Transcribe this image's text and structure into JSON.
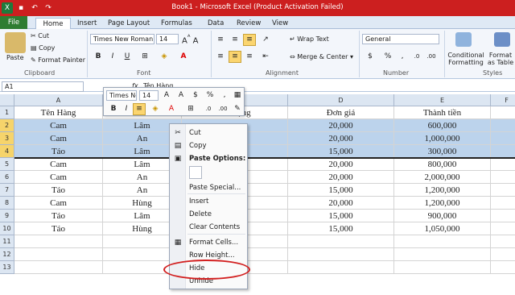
{
  "window": {
    "title": "Book1 -  Microsoft Excel (Product Activation Failed)"
  },
  "tabs": [
    "File",
    "Home",
    "Insert",
    "Page Layout",
    "Formulas",
    "Data",
    "Review",
    "View"
  ],
  "ribbon": {
    "clipboard": {
      "paste": "Paste",
      "cut": "Cut",
      "copy": "Copy",
      "format_painter": "Format Painter",
      "label": "Clipboard"
    },
    "font": {
      "name": "Times New Roman",
      "size": "14",
      "bold": "B",
      "italic": "I",
      "underline": "U",
      "label": "Font"
    },
    "alignment": {
      "wrap": "Wrap Text",
      "merge": "Merge & Center",
      "label": "Alignment"
    },
    "number": {
      "format": "General",
      "currency": "$",
      "percent": "%",
      "comma": ",",
      "label": "Number"
    },
    "styles": {
      "conditional": "Conditional Formatting",
      "table": "Format as Table",
      "label": "Styles"
    }
  },
  "formula_bar": {
    "name": "A1",
    "fx": "fx",
    "value": "Tên Hàng"
  },
  "mini_toolbar": {
    "font": "Times Ne",
    "size": "14",
    "bold": "B",
    "italic": "I"
  },
  "columns": [
    "A",
    "B",
    "C",
    "D",
    "E",
    "F"
  ],
  "rows": [
    "1",
    "2",
    "3",
    "4",
    "5",
    "6",
    "7",
    "8",
    "9",
    "10",
    "11",
    "12",
    "13"
  ],
  "header": [
    "Tên Hàng",
    "Nhân viên",
    "Số lượng",
    "Đơn giá",
    "Thành tiền"
  ],
  "data": [
    [
      "Cam",
      "Lâm",
      "",
      "20,000",
      "600,000"
    ],
    [
      "Cam",
      "An",
      "",
      "20,000",
      "1,000,000"
    ],
    [
      "Táo",
      "Lâm",
      "",
      "15,000",
      "300,000"
    ],
    [
      "Cam",
      "Lâm",
      "",
      "20,000",
      "800,000"
    ],
    [
      "Cam",
      "An",
      "",
      "20,000",
      "2,000,000"
    ],
    [
      "Táo",
      "An",
      "",
      "15,000",
      "1,200,000"
    ],
    [
      "Cam",
      "Hùng",
      "",
      "20,000",
      "1,200,000"
    ],
    [
      "Táo",
      "Lâm",
      "",
      "15,000",
      "900,000"
    ],
    [
      "Táo",
      "Hùng",
      "",
      "15,000",
      "1,050,000"
    ]
  ],
  "context_menu": {
    "cut": "Cut",
    "copy": "Copy",
    "paste_options": "Paste Options:",
    "paste_special": "Paste Special...",
    "insert": "Insert",
    "delete": "Delete",
    "clear": "Clear Contents",
    "format_cells": "Format Cells...",
    "row_height": "Row Height...",
    "hide": "Hide",
    "unhide": "Unhide"
  },
  "colors": {
    "title": "#cc1f1f",
    "file_tab": "#2e7d32",
    "selection": "#bcd3ec",
    "highlight": "#d21f1f"
  }
}
